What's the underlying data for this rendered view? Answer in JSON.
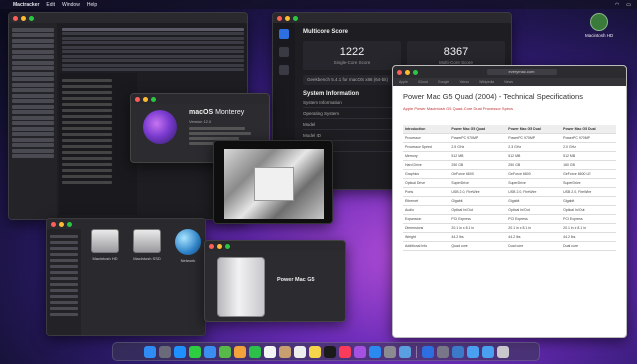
{
  "menubar": {
    "app_name": "Mactracker",
    "items": [
      "Edit",
      "Window",
      "Help"
    ]
  },
  "desktop_icon": {
    "label": "Macintosh HD"
  },
  "geekbench": {
    "title": "Multicore Score",
    "single_score": "1222",
    "single_label": "Single-Core Score",
    "multi_score": "8367",
    "multi_label": "Multi-Core Score",
    "result_line": "Geekbench 5.4.1 for macOS x86 (64-bit)",
    "section": "System Information",
    "rows": [
      {
        "k": "System Information",
        "v": ""
      },
      {
        "k": "Operating System",
        "v": "macOS 12.0"
      },
      {
        "k": "Model",
        "v": "Mac Pro"
      },
      {
        "k": "Model ID",
        "v": "MacPro5,1"
      },
      {
        "k": "Motherboard",
        "v": "Apple Inc."
      }
    ]
  },
  "about": {
    "tabs": [
      "Overview",
      "Displays",
      "Storage",
      "Support",
      "Service"
    ],
    "os_name": "macOS",
    "os_version": "Monterey",
    "version_line": "Version 12.0"
  },
  "safari": {
    "url": "everymac.com",
    "favorites": [
      "Apple",
      "iCloud",
      "Google",
      "Yahoo",
      "Wikipedia",
      "News"
    ],
    "heading": "Power Mac G5 Quad (2004) - Technical Specifications",
    "note": "Apple Power Macintosh G5 Quad-Core Dual Processor Specs",
    "table_headers": [
      "Introduction",
      "Power Mac G5 Quad",
      "Power Mac G5 Dual",
      "Power Mac G5 Dual"
    ],
    "table_rows": [
      [
        "Processor",
        "PowerPC 970MP",
        "PowerPC 970MP",
        "PowerPC 970MP"
      ],
      [
        "Processor Speed",
        "2.5 GHz",
        "2.3 GHz",
        "2.0 GHz"
      ],
      [
        "Memory",
        "512 MB",
        "512 MB",
        "512 MB"
      ],
      [
        "Hard Drive",
        "250 GB",
        "250 GB",
        "160 GB"
      ],
      [
        "Graphics",
        "GeForce 6600",
        "GeForce 6600",
        "GeForce 6600 LE"
      ],
      [
        "Optical Drive",
        "SuperDrive",
        "SuperDrive",
        "SuperDrive"
      ],
      [
        "Ports",
        "USB 2.0, FireWire",
        "USB 2.0, FireWire",
        "USB 2.0, FireWire"
      ],
      [
        "Ethernet",
        "Gigabit",
        "Gigabit",
        "Gigabit"
      ],
      [
        "Audio",
        "Optical In/Out",
        "Optical In/Out",
        "Optical In/Out"
      ],
      [
        "Expansion",
        "PCI Express",
        "PCI Express",
        "PCI Express"
      ],
      [
        "Dimensions",
        "20.1 in x 8.1 in",
        "20.1 in x 8.1 in",
        "20.1 in x 8.1 in"
      ],
      [
        "Weight",
        "44.2 lbs",
        "44.2 lbs",
        "44.2 lbs"
      ],
      [
        "Additional Info",
        "Quad core",
        "Dual core",
        "Dual core"
      ]
    ]
  },
  "finder": {
    "disks": [
      {
        "label": "Macintosh HD"
      },
      {
        "label": "Macintosh SSD"
      },
      {
        "label": "Network"
      }
    ]
  },
  "macpro": {
    "name": "Power Mac G5"
  },
  "dock": {
    "apps": [
      {
        "icon": "finder-icon",
        "color": "#2f8cf5"
      },
      {
        "icon": "launchpad-icon",
        "color": "#6a6a7a"
      },
      {
        "icon": "safari-icon",
        "color": "#1e90ff"
      },
      {
        "icon": "messages-icon",
        "color": "#2ecc40"
      },
      {
        "icon": "mail-icon",
        "color": "#3a8ef0"
      },
      {
        "icon": "maps-icon",
        "color": "#58b848"
      },
      {
        "icon": "photos-icon",
        "color": "#f2a23a"
      },
      {
        "icon": "facetime-icon",
        "color": "#2cc04a"
      },
      {
        "icon": "calendar-icon",
        "color": "#f4f4f4"
      },
      {
        "icon": "contacts-icon",
        "color": "#c8a070"
      },
      {
        "icon": "reminders-icon",
        "color": "#eeeeee"
      },
      {
        "icon": "notes-icon",
        "color": "#f6d54a"
      },
      {
        "icon": "tv-icon",
        "color": "#1a1a1a"
      },
      {
        "icon": "music-icon",
        "color": "#fa3c5a"
      },
      {
        "icon": "podcasts-icon",
        "color": "#a450e0"
      },
      {
        "icon": "appstore-icon",
        "color": "#2a8af0"
      },
      {
        "icon": "settings-icon",
        "color": "#8a8a90"
      },
      {
        "icon": "preview-icon",
        "color": "#5aa0e0"
      }
    ],
    "right_apps": [
      {
        "icon": "geekbench-icon",
        "color": "#2d6ee0"
      },
      {
        "icon": "system-info-icon",
        "color": "#777788"
      },
      {
        "icon": "mactracker-icon",
        "color": "#3a7ac8"
      },
      {
        "icon": "folder-icon",
        "color": "#4aa0f0"
      },
      {
        "icon": "downloads-icon",
        "color": "#4aa0f0"
      },
      {
        "icon": "trash-icon",
        "color": "#c8c8cc"
      }
    ]
  }
}
